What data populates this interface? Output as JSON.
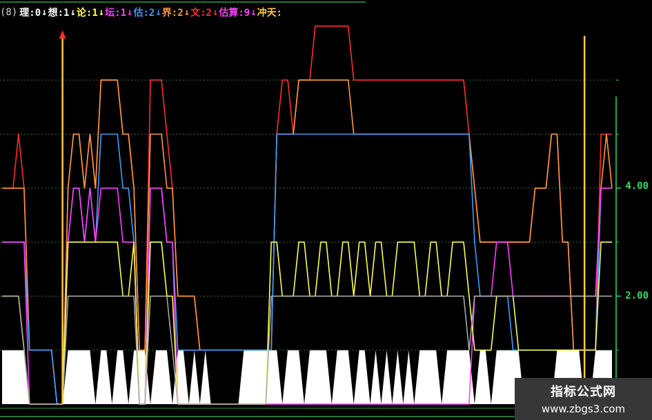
{
  "legend": {
    "prefix": "(8)",
    "items": [
      {
        "label": "理:0",
        "color": "#ffffff",
        "arrow": "↓"
      },
      {
        "label": "想:1",
        "color": "#ffffff",
        "arrow": "↓"
      },
      {
        "label": "论:1",
        "color": "#ffff55",
        "arrow": "↓"
      },
      {
        "label": "坛:1",
        "color": "#ff40ff",
        "arrow": "↓"
      },
      {
        "label": "估:2",
        "color": "#3ba0ff",
        "arrow": "↓"
      },
      {
        "label": "界:2",
        "color": "#ff9a3c",
        "arrow": "↓"
      },
      {
        "label": "文:2",
        "color": "#ff2e2e",
        "arrow": "↓"
      },
      {
        "label": "估算:9",
        "color": "#ff40ff",
        "arrow": "↓"
      },
      {
        "label": "冲天:",
        "color": "#ffcc40",
        "arrow": ""
      }
    ]
  },
  "y_ticks": [
    "4.00",
    "2.00"
  ],
  "watermark": {
    "title": "指标公式网",
    "url": "www.zbgs3.com"
  },
  "chart_data": {
    "type": "line",
    "ylim": [
      0,
      7.1
    ],
    "grid": "dotted",
    "x_count": 112,
    "y_ticks": [
      2,
      4
    ],
    "series": [
      {
        "color": "#ff2e2e",
        "values": [
          4,
          4,
          4,
          5,
          4,
          1,
          1,
          1,
          1,
          1,
          0,
          0,
          4,
          5,
          5,
          4,
          5,
          4,
          6,
          6,
          6,
          6,
          5,
          5,
          4,
          1,
          1,
          6,
          6,
          6,
          5,
          4,
          2,
          2,
          2,
          2,
          1,
          1,
          1,
          1,
          1,
          1,
          1,
          1,
          1,
          1,
          1,
          1,
          1,
          1,
          5,
          6,
          6,
          5,
          6,
          6,
          6,
          7,
          7,
          7,
          7,
          7,
          7,
          7,
          6,
          6,
          6,
          6,
          6,
          6,
          6,
          6,
          6,
          6,
          6,
          6,
          6,
          6,
          6,
          6,
          6,
          6,
          6,
          6,
          6,
          5,
          4,
          3,
          3,
          3,
          3,
          3,
          3,
          3,
          3,
          3,
          3,
          4,
          4,
          4,
          5,
          5,
          3,
          3,
          1,
          1,
          1,
          1,
          1,
          5,
          5,
          5
        ]
      },
      {
        "color": "#ff9a3c",
        "values": [
          4,
          4,
          4,
          4,
          4,
          1,
          1,
          1,
          1,
          1,
          0,
          0,
          4,
          5,
          5,
          4,
          5,
          4,
          6,
          6,
          6,
          6,
          5,
          5,
          4,
          1,
          1,
          5,
          5,
          5,
          4,
          4,
          2,
          2,
          2,
          2,
          1,
          1,
          1,
          1,
          1,
          1,
          1,
          1,
          1,
          1,
          1,
          1,
          1,
          1,
          5,
          5,
          5,
          5,
          6,
          6,
          6,
          6,
          6,
          6,
          6,
          6,
          6,
          6,
          5,
          5,
          5,
          5,
          5,
          5,
          5,
          5,
          5,
          5,
          5,
          5,
          5,
          5,
          5,
          5,
          5,
          5,
          5,
          5,
          5,
          5,
          4,
          3,
          3,
          3,
          3,
          3,
          3,
          3,
          3,
          3,
          3,
          4,
          4,
          4,
          5,
          5,
          3,
          3,
          1,
          1,
          1,
          1,
          1,
          4,
          5,
          4
        ]
      },
      {
        "color": "#3ba0ff",
        "values": [
          3,
          3,
          3,
          3,
          3,
          1,
          1,
          1,
          1,
          1,
          0,
          0,
          3,
          4,
          4,
          3,
          4,
          3,
          5,
          5,
          5,
          5,
          4,
          4,
          3,
          0,
          0,
          4,
          4,
          4,
          3,
          3,
          1,
          1,
          1,
          1,
          1,
          1,
          1,
          1,
          1,
          1,
          1,
          1,
          1,
          1,
          1,
          1,
          1,
          1,
          5,
          5,
          5,
          5,
          5,
          5,
          5,
          5,
          5,
          5,
          5,
          5,
          5,
          5,
          5,
          5,
          5,
          5,
          5,
          5,
          5,
          5,
          5,
          5,
          5,
          5,
          5,
          5,
          5,
          5,
          5,
          5,
          5,
          5,
          5,
          5,
          3,
          2,
          2,
          2,
          2,
          2,
          2,
          1,
          1,
          1,
          1,
          1,
          1,
          1,
          1,
          1,
          1,
          1,
          1,
          1,
          1,
          1,
          1,
          4,
          4,
          4
        ]
      },
      {
        "color": "#ff40ff",
        "values": [
          3,
          3,
          3,
          3,
          3,
          0,
          0,
          0,
          0,
          0,
          0,
          0,
          3,
          4,
          4,
          3,
          4,
          3,
          4,
          4,
          4,
          4,
          3,
          3,
          3,
          0,
          0,
          4,
          4,
          4,
          3,
          3,
          0,
          0,
          0,
          0,
          0,
          0,
          0,
          0,
          0,
          0,
          0,
          0,
          0,
          0,
          0,
          0,
          0,
          0,
          0,
          0,
          0,
          0,
          0,
          0,
          0,
          0,
          0,
          0,
          0,
          0,
          0,
          0,
          0,
          0,
          0,
          0,
          0,
          0,
          0,
          0,
          0,
          0,
          0,
          0,
          0,
          0,
          0,
          0,
          0,
          0,
          0,
          0,
          0,
          0,
          2,
          2,
          2,
          2,
          3,
          3,
          3,
          2,
          2,
          2,
          2,
          2,
          2,
          2,
          2,
          2,
          2,
          2,
          2,
          2,
          2,
          2,
          2,
          4,
          4,
          4
        ]
      },
      {
        "color": "#ffff55",
        "values": [
          2,
          2,
          2,
          2,
          1,
          0,
          0,
          0,
          0,
          0,
          0,
          0,
          3,
          3,
          3,
          3,
          3,
          3,
          3,
          3,
          3,
          3,
          2,
          2,
          3,
          0,
          0,
          3,
          3,
          3,
          2,
          2,
          0,
          0,
          0,
          0,
          0,
          0,
          0,
          0,
          0,
          0,
          0,
          0,
          0,
          0,
          0,
          0,
          0,
          3,
          3,
          2,
          2,
          2,
          3,
          3,
          2,
          2,
          3,
          3,
          2,
          2,
          3,
          3,
          2,
          3,
          3,
          2,
          3,
          3,
          2,
          2,
          3,
          3,
          3,
          3,
          2,
          2,
          3,
          3,
          2,
          2,
          3,
          3,
          3,
          2,
          1,
          1,
          1,
          1,
          2,
          2,
          2,
          2,
          1,
          1,
          1,
          1,
          1,
          1,
          1,
          1,
          1,
          1,
          1,
          1,
          1,
          1,
          1,
          3,
          3,
          3
        ]
      },
      {
        "color": "#a8a8a8",
        "values": [
          2,
          2,
          2,
          2,
          1,
          0,
          0,
          0,
          0,
          0,
          0,
          0,
          2,
          2,
          2,
          2,
          2,
          2,
          2,
          2,
          2,
          2,
          2,
          2,
          2,
          0,
          0,
          2,
          2,
          2,
          2,
          1,
          0,
          0,
          0,
          0,
          0,
          0,
          0,
          0,
          0,
          0,
          0,
          0,
          0,
          0,
          0,
          0,
          0,
          2,
          2,
          2,
          2,
          2,
          2,
          2,
          2,
          2,
          2,
          2,
          2,
          2,
          2,
          2,
          2,
          2,
          2,
          2,
          2,
          2,
          2,
          2,
          2,
          2,
          2,
          2,
          2,
          2,
          2,
          2,
          2,
          2,
          2,
          2,
          2,
          1,
          2,
          2,
          2,
          2,
          2,
          2,
          2,
          2,
          2,
          2,
          2,
          2,
          2,
          2,
          2,
          2,
          2,
          2,
          2,
          2,
          2,
          2,
          2,
          2,
          2,
          2
        ]
      },
      {
        "color": "#ffffff",
        "type": "area",
        "values": [
          1,
          1,
          1,
          1,
          1,
          0,
          0,
          0,
          0,
          0,
          0,
          0,
          1,
          1,
          1,
          1,
          1,
          0,
          1,
          1,
          0,
          1,
          1,
          0,
          1,
          1,
          1,
          0,
          1,
          1,
          1,
          0,
          1,
          1,
          0,
          1,
          0,
          1,
          0,
          0,
          0,
          0,
          0,
          0,
          1,
          1,
          1,
          1,
          1,
          1,
          1,
          0,
          1,
          1,
          1,
          0,
          1,
          1,
          1,
          1,
          0,
          1,
          1,
          1,
          0,
          1,
          1,
          0,
          1,
          0,
          1,
          0,
          1,
          0,
          1,
          0,
          1,
          1,
          1,
          1,
          0,
          1,
          1,
          1,
          1,
          1,
          0,
          1,
          1,
          0,
          1,
          1,
          1,
          1,
          1,
          0,
          0,
          0,
          0,
          0,
          0,
          1,
          1,
          1,
          1,
          1,
          0,
          0,
          1,
          1,
          1,
          1
        ]
      }
    ],
    "markers": [
      {
        "x": 11,
        "color": "#ffcc40",
        "arrow": true
      },
      {
        "x": 106,
        "color": "#ffcc40",
        "arrow": false
      }
    ]
  }
}
